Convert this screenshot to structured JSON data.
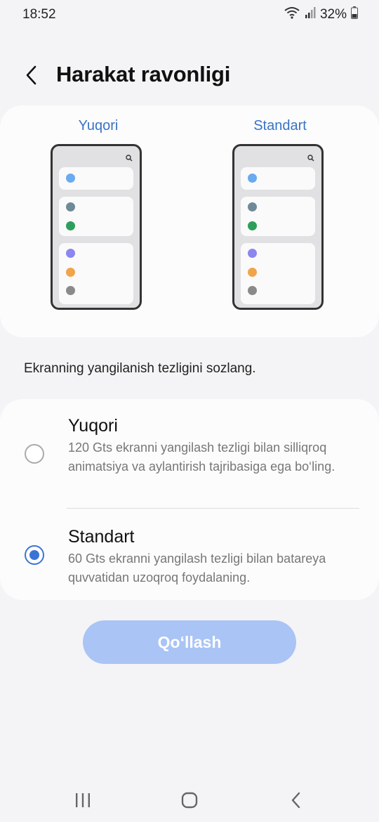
{
  "status_bar": {
    "time": "18:52",
    "battery_percent": "32%",
    "icons": [
      "wifi-icon",
      "signal-icon",
      "battery-icon"
    ]
  },
  "header": {
    "back_icon": "chevron-left-icon",
    "title": "Harakat ravonligi"
  },
  "preview": {
    "left_label": "Yuqori",
    "right_label": "Standart",
    "dot_colors": [
      "#6aaaf0",
      "#6e8a99",
      "#2e9e5b",
      "#8c86ef",
      "#f2a449",
      "#8a8a8a"
    ]
  },
  "instruction": "Ekranning yangilanish tezligini sozlang.",
  "options": [
    {
      "title": "Yuqori",
      "description": "120 Gts ekranni yangilash tezligi bilan silliqroq animatsiya va aylantirish tajribasiga ega bo‘ling.",
      "selected": false
    },
    {
      "title": "Standart",
      "description": "60 Gts ekranni yangilash tezligi bilan batareya quvvatidan uzoqroq foydalaning.",
      "selected": true
    }
  ],
  "apply_button": "Qo‘llash",
  "colors": {
    "accent": "#3b74d6",
    "button_disabled": "#a9c4f5",
    "label_blue": "#3a73c4"
  },
  "nav_bar": [
    "recents-icon",
    "home-icon",
    "back-icon"
  ]
}
